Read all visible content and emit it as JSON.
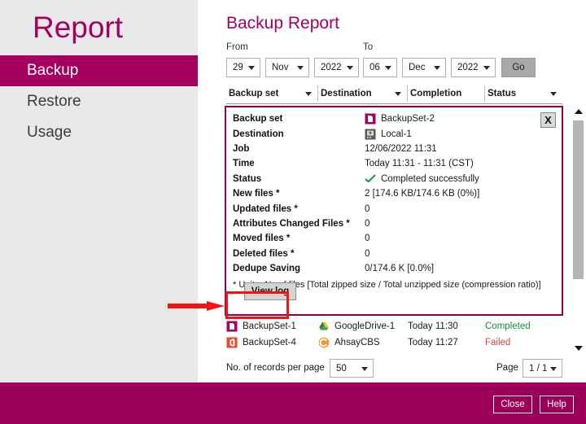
{
  "sidebar": {
    "title": "Report",
    "items": [
      {
        "label": "Backup",
        "active": true
      },
      {
        "label": "Restore",
        "active": false
      },
      {
        "label": "Usage",
        "active": false
      }
    ]
  },
  "main": {
    "page_title": "Backup Report",
    "filter": {
      "from_label": "From",
      "to_label": "To",
      "from_day": "29",
      "from_month": "Nov",
      "from_year": "2022",
      "to_day": "06",
      "to_month": "Dec",
      "to_year": "2022",
      "go_label": "Go"
    },
    "table_headers": {
      "backup_set": "Backup set",
      "destination": "Destination",
      "completion": "Completion",
      "status": "Status"
    },
    "detail_panel": {
      "close_label": "X",
      "view_log_label": "View log",
      "footnote": "* Unit = No of files [Total zipped size / Total unzipped size (compression ratio)]",
      "rows": [
        {
          "label": "Backup set",
          "value": "BackupSet-2",
          "icon": "backup-set-icon"
        },
        {
          "label": "Destination",
          "value": "Local-1",
          "icon": "local-destination-icon"
        },
        {
          "label": "Job",
          "value": "12/06/2022 11:31",
          "icon": ""
        },
        {
          "label": "Time",
          "value": "Today 11:31 - 11:31 (CST)",
          "icon": ""
        },
        {
          "label": "Status",
          "value": "Completed successfully",
          "icon": "check-icon"
        },
        {
          "label": "New files *",
          "value": "2 [174.6 KB/174.6 KB (0%)]",
          "icon": ""
        },
        {
          "label": "Updated files *",
          "value": "0",
          "icon": ""
        },
        {
          "label": "Attributes Changed Files *",
          "value": "0",
          "icon": ""
        },
        {
          "label": "Moved files *",
          "value": "0",
          "icon": ""
        },
        {
          "label": "Deleted files *",
          "value": "0",
          "icon": ""
        },
        {
          "label": "Dedupe Saving",
          "value": "0/174.6 K [0.0%]",
          "icon": ""
        }
      ]
    },
    "rows": [
      {
        "set_icon": "backup-set-icon",
        "set": "BackupSet-1",
        "dest_icon": "google-drive-icon",
        "destination": "GoogleDrive-1",
        "completion": "Today 11:30",
        "status": "Completed",
        "status_kind": "completed"
      },
      {
        "set_icon": "office-backup-set-icon",
        "set": "BackupSet-4",
        "dest_icon": "ahsay-cbs-icon",
        "destination": "AhsayCBS",
        "completion": "Today 11:27",
        "status": "Failed",
        "status_kind": "failed"
      }
    ],
    "pager": {
      "records_label": "No. of records per page",
      "records_value": "50",
      "page_label": "Page",
      "page_value": "1 / 1"
    }
  },
  "bottom_bar": {
    "close_label": "Close",
    "help_label": "Help"
  },
  "colors": {
    "brand_magenta": "#a5005f",
    "bottom_bar": "#9c0058",
    "panel_border": "#8e0055",
    "status_completed": "#12913f",
    "status_failed": "#e8403a",
    "annotation_red": "#f01414",
    "sidebar_bg": "#e9e9e9"
  }
}
